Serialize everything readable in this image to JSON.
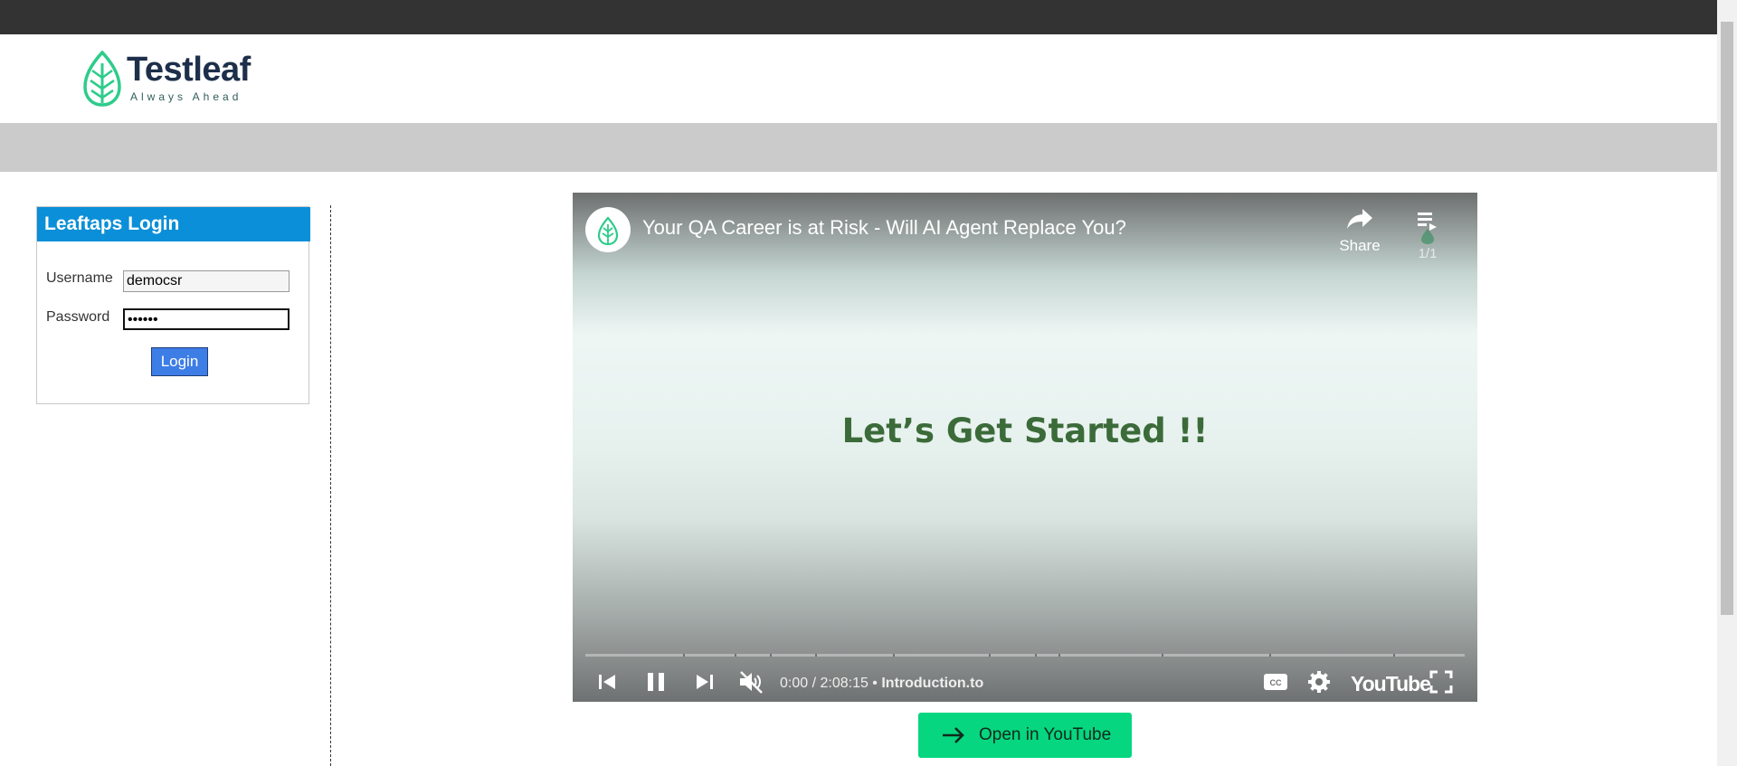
{
  "brand": {
    "name": "Testleaf",
    "tagline": "Always Ahead",
    "leaf_color": "#2ecc8b",
    "text_color": "#1d2f4a"
  },
  "login": {
    "title": "Leaftaps Login",
    "username_label": "Username",
    "username_value": "democsr",
    "password_label": "Password",
    "password_value": "••••••",
    "button_label": "Login"
  },
  "video": {
    "title": "Your QA Career is at Risk - Will AI Agent Replace You?",
    "share_label": "Share",
    "playlist_count": "1/1",
    "center_text": "Let’s Get Started !!",
    "time_current": "0:00",
    "time_total": "2:08:15",
    "time_display": "0:00 / 2:08:15",
    "chapter": "Introduction.to",
    "platform": "YouTube",
    "muted": true,
    "playing": true
  },
  "open_youtube": {
    "label": "Open in YouTube",
    "color": "#06d67f"
  },
  "colors": {
    "top_bar": "#333333",
    "nav_bar": "#cbcbcb",
    "login_header": "#0b8fd8",
    "login_button": "#3d7de6"
  }
}
